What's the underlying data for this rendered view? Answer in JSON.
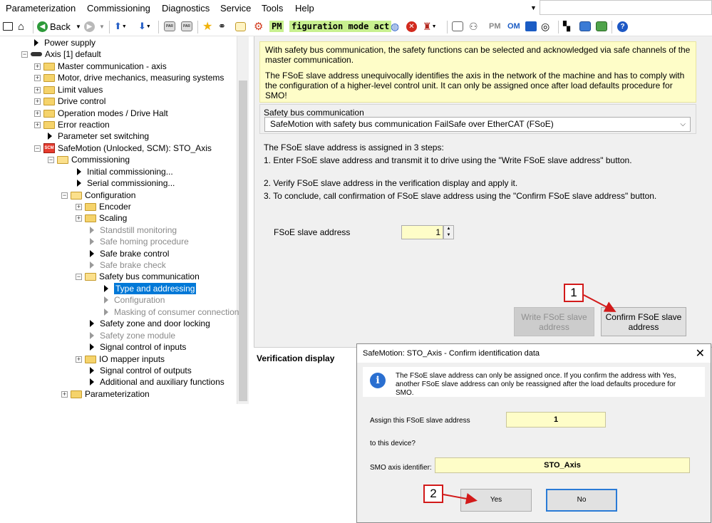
{
  "menu": {
    "items": [
      "Parameterization",
      "Commissioning",
      "Diagnostics",
      "Service",
      "Tools",
      "Help"
    ]
  },
  "toolbar": {
    "back_label": "Back",
    "pm_label": "PM",
    "mode_text": "figuration mode act",
    "pm2_label": "PM",
    "om_label": "OM",
    "icons": [
      "window-icon",
      "home-icon",
      "back-arrow-icon",
      "forward-arrow-icon",
      "download-icon",
      "upload-icon",
      "par-icon",
      "par-icon-2",
      "star-icon",
      "binoculars-icon",
      "table-icon",
      "gear-icon",
      "globe-icon",
      "stop-icon",
      "servo-icon",
      "chart-icon",
      "person-icon",
      "cm-icon",
      "save-icon",
      "split-icon",
      "compare-icon",
      "sync-icon",
      "help-icon"
    ]
  },
  "tree": {
    "power_supply": "Power supply",
    "axis": "Axis [1] default",
    "master_comm": "Master communication - axis",
    "motor": "Motor, drive mechanics, measuring systems",
    "limit_values": "Limit values",
    "drive_control": "Drive control",
    "operation_modes": "Operation modes / Drive Halt",
    "error_reaction": "Error reaction",
    "param_set_switching": "Parameter set switching",
    "safemotion": "SafeMotion (Unlocked, SCM): STO_Axis",
    "smo_icon_text": "SCM",
    "commissioning": "Commissioning",
    "initial_comm": "Initial commissioning...",
    "serial_comm": "Serial commissioning...",
    "configuration": "Configuration",
    "encoder": "Encoder",
    "scaling": "Scaling",
    "standstill": "Standstill monitoring",
    "safe_homing": "Safe homing procedure",
    "safe_brake_control": "Safe brake control",
    "safe_brake_check": "Safe brake check",
    "safety_bus": "Safety bus communication",
    "type_addressing": "Type and addressing",
    "configuration2": "Configuration",
    "masking": "Masking of consumer connection",
    "safety_zone_door": "Safety zone and door locking",
    "safety_zone_module": "Safety zone module",
    "signal_inputs": "Signal control of inputs",
    "io_mapper": "IO mapper inputs",
    "signal_outputs": "Signal control of outputs",
    "additional": "Additional and auxiliary functions",
    "parameterization": "Parameterization"
  },
  "main": {
    "info_p1": "With safety bus communication, the safety functions can be selected and acknowledged via safe channels of the master communication.",
    "info_p2": "The FSoE slave address unequivocally identifies the axis in the network of the machine and has to comply with the configuration of a higher-level control unit. It can only be assigned once after load defaults procedure for SMO!",
    "bus_group_label": "Safety bus communication",
    "bus_select_value": "SafeMotion with safety bus communication FailSafe over EtherCAT (FSoE)",
    "steps_title": "The FSoE slave address is assigned in 3 steps:",
    "step1": "1.  Enter FSoE slave address and transmit it to drive using the \"Write FSoE slave address\" button.",
    "step2": "2.  Verify FSoE slave address in the verification display and apply it.",
    "step3": "3.  To conclude, call confirmation of FSoE slave address using the \"Confirm FSoE slave address\" button.",
    "fsoe_label": "FSoE slave address",
    "fsoe_value": "1",
    "write_btn": "Write FSoE slave address",
    "confirm_btn": "Confirm FSoE slave address",
    "verification_title": "Verification display",
    "callout1": "1",
    "callout2": "2"
  },
  "dialog": {
    "title": "SafeMotion: STO_Axis - Confirm identification data",
    "message": "The FSoE slave address can only be assigned once. If you confirm the address with Yes, another FSoE slave address can only be reassigned after the load defaults procedure for SMO.",
    "assign_label": "Assign this FSoE slave address",
    "assign_value": "1",
    "to_device": "to this device?",
    "smo_label": "SMO axis identifier:",
    "smo_value": "STO_Axis",
    "yes": "Yes",
    "no": "No"
  },
  "colors": {
    "info_bg": "#fefdc8",
    "callout_red": "#d21a1a",
    "selection_blue": "#0078d7"
  }
}
